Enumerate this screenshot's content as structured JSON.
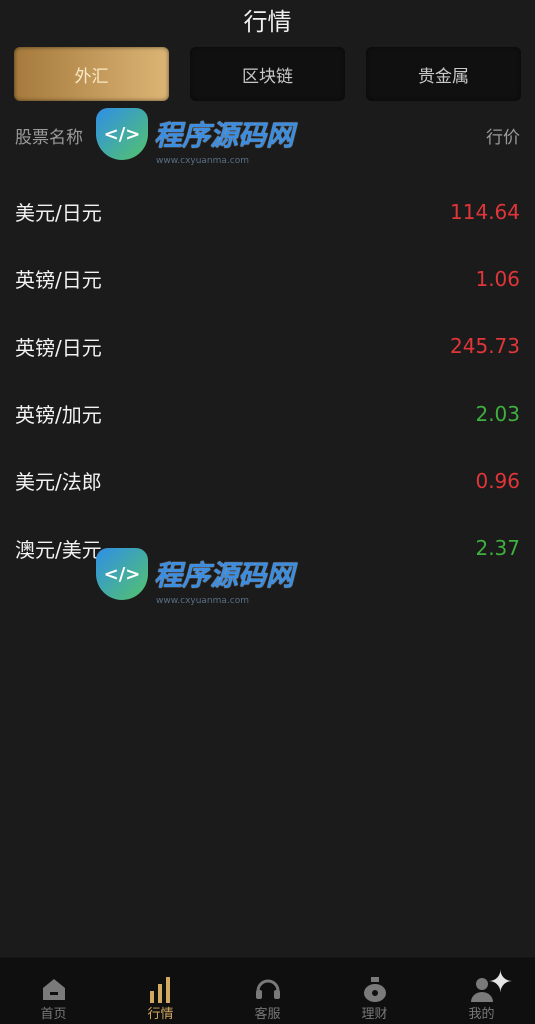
{
  "header": {
    "title": "行情"
  },
  "tabs": [
    {
      "label": "外汇",
      "active": true
    },
    {
      "label": "区块链",
      "active": false
    },
    {
      "label": "贵金属",
      "active": false
    }
  ],
  "columns": {
    "name": "股票名称",
    "price": "行价"
  },
  "rows": [
    {
      "name": "美元/日元",
      "price": "114.64",
      "color": "#e0363a"
    },
    {
      "name": "英镑/日元",
      "price": "1.06",
      "color": "#e0363a"
    },
    {
      "name": "英镑/日元",
      "price": "245.73",
      "color": "#e0363a"
    },
    {
      "name": "英镑/加元",
      "price": "2.03",
      "color": "#3fb03f"
    },
    {
      "name": "美元/法郎",
      "price": "0.96",
      "color": "#e0363a"
    },
    {
      "name": "澳元/美元",
      "price": "2.37",
      "color": "#3fb03f"
    }
  ],
  "watermark": {
    "text": "程序源码网",
    "url": "www.cxyuanma.com",
    "logo": "</>"
  },
  "nav": [
    {
      "label": "首页",
      "icon": "home-icon",
      "active": false
    },
    {
      "label": "行情",
      "icon": "chart-icon",
      "active": true
    },
    {
      "label": "客服",
      "icon": "headset-icon",
      "active": false
    },
    {
      "label": "理财",
      "icon": "money-bag-icon",
      "active": false
    },
    {
      "label": "我的",
      "icon": "user-icon",
      "active": false
    }
  ],
  "colors": {
    "accent": "#d2a960",
    "up": "#e0363a",
    "down": "#3fb03f",
    "background": "#1b1b1b"
  }
}
